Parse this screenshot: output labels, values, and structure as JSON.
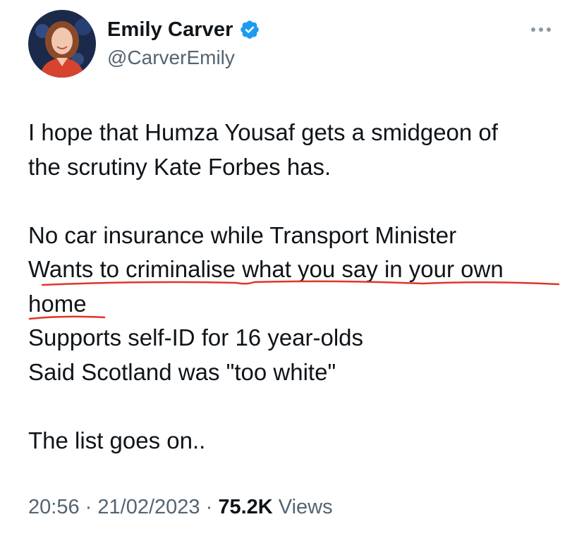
{
  "author": {
    "display_name": "Emily Carver",
    "handle": "@CarverEmily",
    "verified": true,
    "avatar_icon": "profile-photo"
  },
  "more_icon": "ellipsis-icon",
  "tweet": {
    "lines": [
      "I hope that Humza Yousaf gets a smidgeon of",
      "the scrutiny Kate Forbes has.",
      "",
      "No car insurance while Transport Minister",
      "Wants to criminalise what you say in your own",
      "home",
      "Supports self-ID for 16 year-olds",
      "Said Scotland was \"too white\"",
      "",
      "The list goes on.."
    ]
  },
  "meta": {
    "time": "20:56",
    "date": "21/02/2023",
    "views_count": "75.2K",
    "views_label": "Views",
    "separator": "·"
  },
  "colors": {
    "text": "#0f1419",
    "secondary": "#536471",
    "verified": "#1d9bf0",
    "annotation": "#e0352b"
  }
}
